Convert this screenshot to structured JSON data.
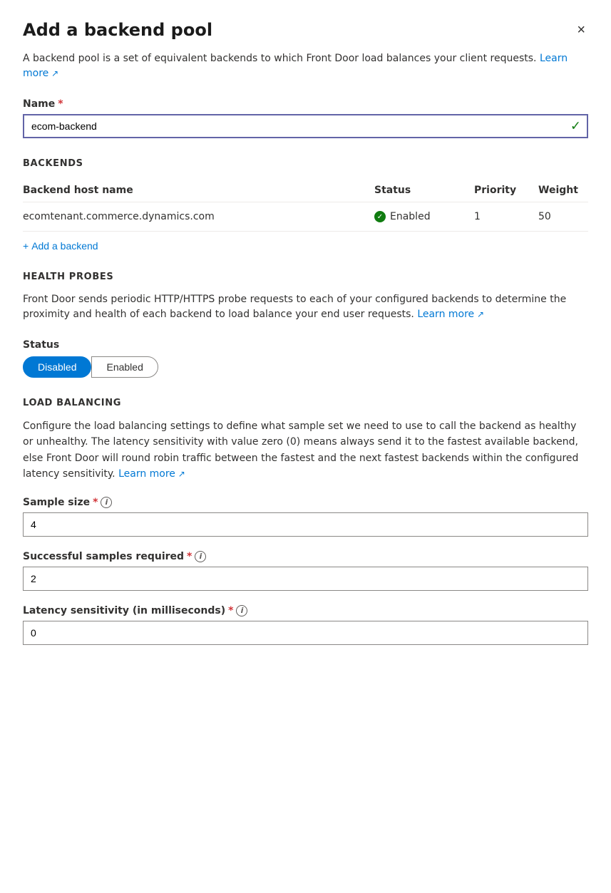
{
  "panel": {
    "title": "Add a backend pool",
    "close_label": "×"
  },
  "intro": {
    "description": "A backend pool is a set of equivalent backends to which Front Door load balances your client requests.",
    "learn_more_text": "Learn more"
  },
  "name_field": {
    "label": "Name",
    "required_marker": "*",
    "value": "ecom-backend",
    "check_icon": "✓"
  },
  "backends": {
    "section_header": "BACKENDS",
    "columns": [
      "Backend host name",
      "Status",
      "Priority",
      "Weight"
    ],
    "rows": [
      {
        "host_name": "ecomtenant.commerce.dynamics.com",
        "status": "Enabled",
        "priority": "1",
        "weight": "50"
      }
    ],
    "add_label": "Add a backend"
  },
  "health_probes": {
    "section_header": "HEALTH PROBES",
    "description": "Front Door sends periodic HTTP/HTTPS probe requests to each of your configured backends to determine the proximity and health of each backend to load balance your end user requests.",
    "learn_more_text": "Learn more",
    "status_label": "Status",
    "toggle_options": [
      "Disabled",
      "Enabled"
    ],
    "active_toggle": "Disabled"
  },
  "load_balancing": {
    "section_header": "LOAD BALANCING",
    "description": "Configure the load balancing settings to define what sample set we need to use to call the backend as healthy or unhealthy. The latency sensitivity with value zero (0) means always send it to the fastest available backend, else Front Door will round robin traffic between the fastest and the next fastest backends within the configured latency sensitivity.",
    "learn_more_text": "Learn more",
    "sample_size": {
      "label": "Sample size",
      "required_marker": "*",
      "value": "4"
    },
    "successful_samples": {
      "label": "Successful samples required",
      "required_marker": "*",
      "value": "2"
    },
    "latency_sensitivity": {
      "label": "Latency sensitivity (in milliseconds)",
      "required_marker": "*",
      "value": "0"
    }
  }
}
